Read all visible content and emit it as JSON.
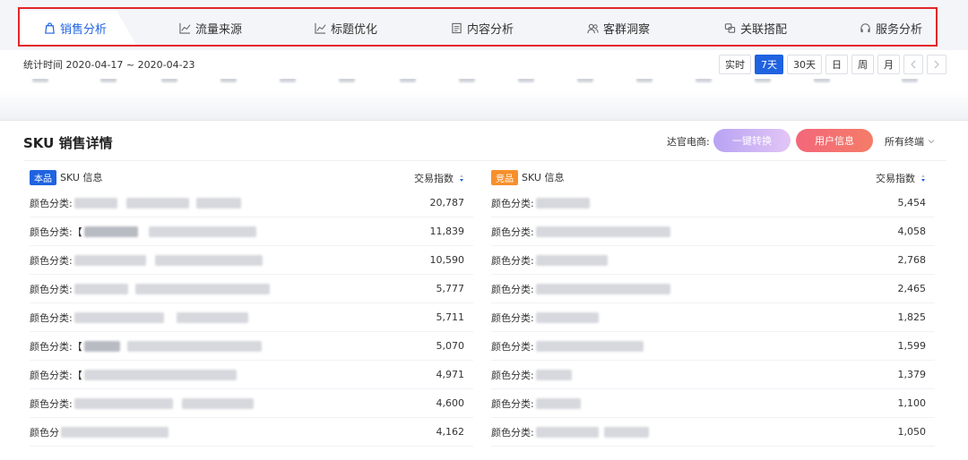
{
  "nav": {
    "tabs": [
      {
        "label": "销售分析",
        "icon": "shopping-bag-icon",
        "active": true
      },
      {
        "label": "流量来源",
        "icon": "trend-line-icon"
      },
      {
        "label": "标题优化",
        "icon": "trend-line-icon"
      },
      {
        "label": "内容分析",
        "icon": "document-icon"
      },
      {
        "label": "客群洞察",
        "icon": "users-icon"
      },
      {
        "label": "关联搭配",
        "icon": "link-icon"
      },
      {
        "label": "服务分析",
        "icon": "headset-icon"
      }
    ]
  },
  "date_bar": {
    "text": "统计时间 2020-04-17 ~ 2020-04-23",
    "ranges": [
      "实时",
      "7天",
      "30天",
      "日",
      "周",
      "月"
    ],
    "active_range": "7天"
  },
  "sku": {
    "title": "SKU 销售详情",
    "platform_label": "达官电商:",
    "convert_button": "一键转换",
    "user_info_button": "用户信息",
    "terminal_select": "所有终端",
    "left": {
      "tag": "本品",
      "header": "SKU 信息",
      "metric": "交易指数",
      "rows": [
        {
          "label": "颜色分类:",
          "value": "20,787"
        },
        {
          "label": "颜色分类:【",
          "value": "11,839"
        },
        {
          "label": "颜色分类:",
          "value": "10,590"
        },
        {
          "label": "颜色分类:",
          "value": "5,777"
        },
        {
          "label": "颜色分类:",
          "value": "5,711"
        },
        {
          "label": "颜色分类:【",
          "value": "5,070"
        },
        {
          "label": "颜色分类:【",
          "value": "4,971"
        },
        {
          "label": "颜色分类:",
          "value": "4,600"
        },
        {
          "label": "颜色分",
          "value": "4,162"
        }
      ]
    },
    "right": {
      "tag": "竞品",
      "header": "SKU 信息",
      "metric": "交易指数",
      "rows": [
        {
          "label": "颜色分类:",
          "value": "5,454"
        },
        {
          "label": "颜色分类:",
          "value": "4,058"
        },
        {
          "label": "颜色分类:",
          "value": "2,768"
        },
        {
          "label": "颜色分类:",
          "value": "2,465"
        },
        {
          "label": "颜色分类:",
          "value": "1,825"
        },
        {
          "label": "颜色分类:",
          "value": "1,599"
        },
        {
          "label": "颜色分类:",
          "value": "1,379"
        },
        {
          "label": "颜色分类:",
          "value": "1,100"
        },
        {
          "label": "颜色分类:",
          "value": "1,050"
        }
      ]
    }
  },
  "colors": {
    "accent": "#1f63e0",
    "highlight_border": "#e3262b",
    "own_tag": "#1f63e0",
    "competitor_tag": "#f7902b"
  }
}
